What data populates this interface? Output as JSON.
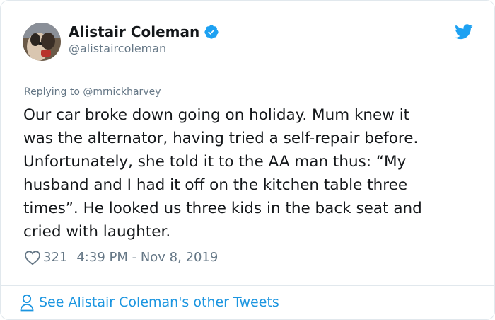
{
  "author": {
    "display_name": "Alistair Coleman",
    "handle": "@alistaircoleman",
    "verified": true,
    "avatar_icon": "profile-photo"
  },
  "reply": {
    "prefix": "Replying to",
    "mention": "@mrnickharvey"
  },
  "tweet": {
    "lines": [
      "Our car broke down going on holiday. Mum knew it",
      "was the alternator, having tried a self-repair before.",
      "Unfortunately, she told it to the AA man thus: “My",
      "husband and I had it off on the kitchen table three",
      "times”. He looked us three kids in the back seat and",
      "cried with laughter."
    ]
  },
  "meta": {
    "likes": "321",
    "timestamp": "4:39 PM - Nov 8, 2019"
  },
  "footer": {
    "see_more_label": "See Alistair Coleman's other Tweets"
  },
  "icons": {
    "brand": "twitter-bird-icon",
    "verified": "verified-badge-icon",
    "like": "heart-icon",
    "footer": "person-icon"
  },
  "colors": {
    "brand_blue": "#1da1f2",
    "link_blue": "#1b95e0",
    "text_primary": "#14171a",
    "text_secondary": "#657786",
    "border": "#e1e8ed"
  }
}
